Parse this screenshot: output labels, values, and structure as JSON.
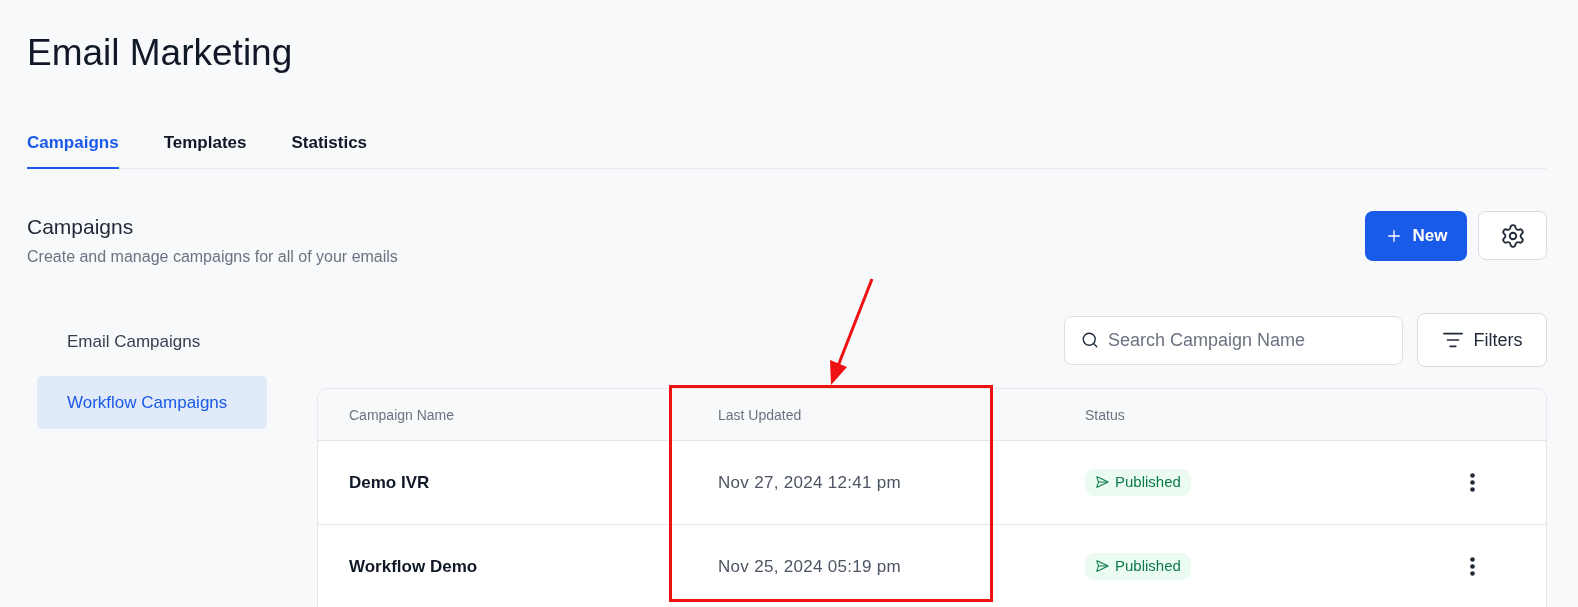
{
  "page": {
    "title": "Email Marketing"
  },
  "tabs": [
    {
      "label": "Campaigns",
      "selected": true
    },
    {
      "label": "Templates",
      "selected": false
    },
    {
      "label": "Statistics",
      "selected": false
    }
  ],
  "section": {
    "title": "Campaigns",
    "subtitle": "Create and manage campaigns for all of your emails",
    "new_button": "New"
  },
  "sidebar": {
    "items": [
      {
        "label": "Email Campaigns",
        "selected": false
      },
      {
        "label": "Workflow Campaigns",
        "selected": true
      }
    ]
  },
  "search": {
    "placeholder": "Search Campaign Name"
  },
  "filters_button": "Filters",
  "table": {
    "columns": [
      "Campaign Name",
      "Last Updated",
      "Status"
    ],
    "rows": [
      {
        "name": "Demo IVR",
        "last_updated": "Nov 27, 2024 12:41 pm",
        "status": "Published"
      },
      {
        "name": "Workflow Demo",
        "last_updated": "Nov 25, 2024 05:19 pm",
        "status": "Published"
      }
    ]
  },
  "annotations": [
    {
      "kind": "arrow"
    },
    {
      "kind": "highlight_box"
    }
  ]
}
